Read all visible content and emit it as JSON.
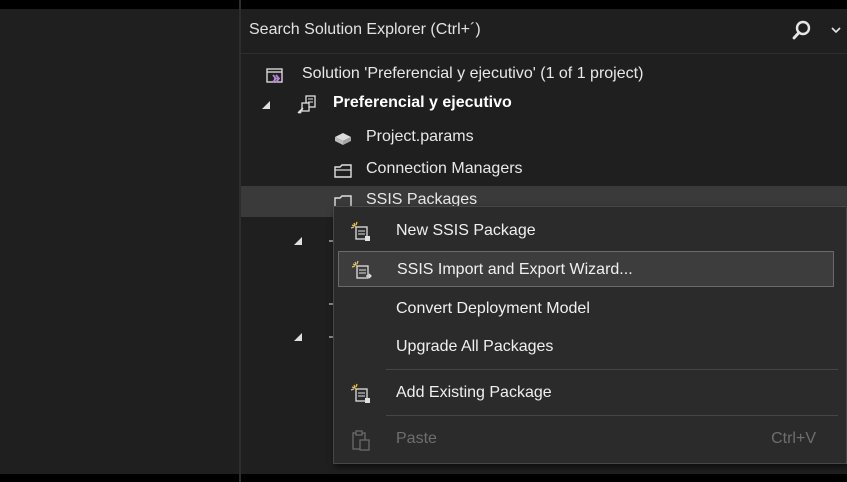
{
  "search": {
    "placeholder": "Search Solution Explorer (Ctrl+´)"
  },
  "tree": {
    "solution_label": "Solution 'Preferencial y ejecutivo' (1 of 1 project)",
    "project_label": "Preferencial y ejecutivo",
    "project_params_label": "Project.params",
    "connection_managers_label": "Connection Managers",
    "ssis_packages_label": "SSIS Packages"
  },
  "context_menu": {
    "items": [
      {
        "label": "New SSIS Package",
        "icon": "package-wizard-icon"
      },
      {
        "label": "SSIS Import and Export Wizard...",
        "icon": "package-wizard-icon"
      },
      {
        "label": "Convert Deployment Model",
        "icon": ""
      },
      {
        "label": "Upgrade All Packages",
        "icon": ""
      },
      {
        "label": "Add Existing Package",
        "icon": "package-wizard-icon"
      },
      {
        "label": "Paste",
        "icon": "paste-icon",
        "shortcut": "Ctrl+V",
        "disabled": true
      }
    ]
  },
  "colors": {
    "background": "#1f1f1f",
    "menu_background": "#2b2b2b",
    "selection": "#3a3a3a",
    "accent_purple": "#b180d7"
  }
}
